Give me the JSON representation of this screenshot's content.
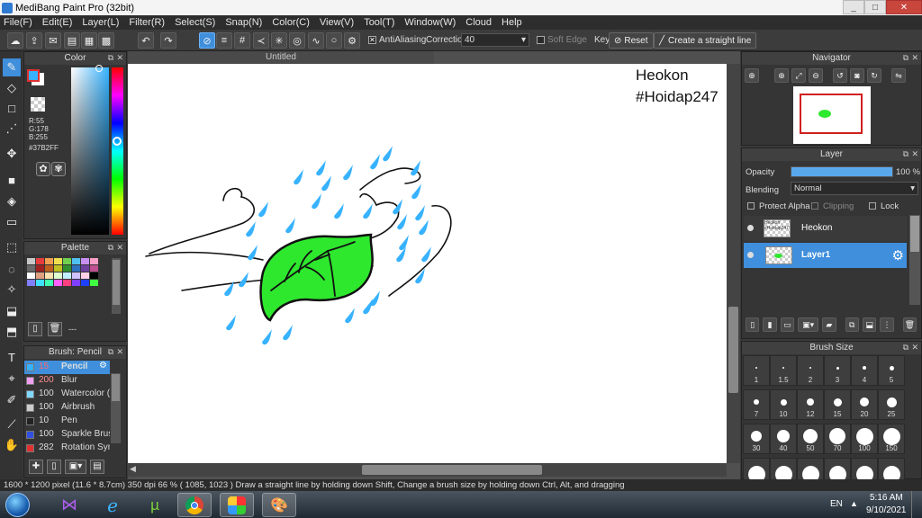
{
  "window": {
    "title": "MediBang Paint Pro (32bit)",
    "minimize": "_",
    "maximize": "□",
    "close": "✕"
  },
  "menu": [
    "File(F)",
    "Edit(E)",
    "Layer(L)",
    "Filter(R)",
    "Select(S)",
    "Snap(N)",
    "Color(C)",
    "View(V)",
    "Tool(T)",
    "Window(W)",
    "Cloud",
    "Help"
  ],
  "toolbar": {
    "antialiasing": "AntiAliasing",
    "correction_label": "Correction",
    "correction_value": "40",
    "soft_edge": "Soft Edge",
    "key_label": "Key",
    "reset": "Reset",
    "straight_line": "Create a straight line"
  },
  "color_panel": {
    "title": "Color",
    "r": "R:55",
    "g": "G:178",
    "b": "B:255",
    "hex": "#37B2FF",
    "primary_color": "#37B2FF",
    "secondary_color": "#FFFFFF"
  },
  "palette_panel": {
    "title": "Palette",
    "more": "---",
    "swatches": [
      "#c8c8c8",
      "#e63c3c",
      "#f0a050",
      "#f0e050",
      "#70d050",
      "#50c0f0",
      "#c890f0",
      "#f8a0c8",
      "#6a6a6a",
      "#a02020",
      "#c06020",
      "#c0c020",
      "#309030",
      "#3070c0",
      "#7040a0",
      "#c05090",
      "#ffffff",
      "#e0a080",
      "#ffe0b0",
      "#e0ffd0",
      "#c0f0ff",
      "#d0c0ff",
      "#ffd0e8",
      "#000000",
      "#8080ff",
      "#40e0ff",
      "#40ffb0",
      "#ff60ff",
      "#ff4080",
      "#8040ff",
      "#2040ff",
      "#40ff40"
    ]
  },
  "brush_panel": {
    "title": "Brush: Pencil",
    "items": [
      {
        "size": "15",
        "name": "Pencil",
        "color": "#37B2FF",
        "selected": true
      },
      {
        "size": "200",
        "name": "Blur",
        "color": "#f0a0f0",
        "selected": false
      },
      {
        "size": "100",
        "name": "Watercolor (V",
        "color": "#80d8ff",
        "selected": false
      },
      {
        "size": "100",
        "name": "Airbrush",
        "color": "#cccccc",
        "selected": false
      },
      {
        "size": "10",
        "name": "Pen",
        "color": "#222222",
        "selected": false
      },
      {
        "size": "100",
        "name": "Sparkle Brush",
        "color": "#3050e0",
        "selected": false
      },
      {
        "size": "282",
        "name": "Rotation Sym",
        "color": "#e03030",
        "selected": false
      }
    ]
  },
  "document": {
    "tab": "Untitled",
    "watermark_line1": "Heokon",
    "watermark_line2": "#Hoidap247"
  },
  "navigator": {
    "title": "Navigator"
  },
  "layer_panel": {
    "title": "Layer",
    "opacity_label": "Opacity",
    "opacity_value": "100 %",
    "opacity_percent": 100,
    "blending_label": "Blending",
    "blending_value": "Normal",
    "protect_alpha": "Protect Alpha",
    "clipping": "Clipping",
    "lock": "Lock",
    "layers": [
      {
        "name": "Heokon",
        "selected": false
      },
      {
        "name": "Layer1",
        "selected": true
      }
    ],
    "thumb_text": "Heokon #Hoidap247"
  },
  "brush_size_panel": {
    "title": "Brush Size",
    "sizes": [
      "1",
      "1.5",
      "2",
      "3",
      "4",
      "5",
      "7",
      "10",
      "12",
      "15",
      "20",
      "25",
      "30",
      "40",
      "50",
      "70",
      "100",
      "150"
    ]
  },
  "status": {
    "text": "1600 * 1200 pixel   (11.6 * 8.7cm)   350 dpi   66 %   ( 1085, 1023 )   Draw a straight line by holding down Shift, Change a brush size by holding down Ctrl, Alt, and dragging"
  },
  "taskbar": {
    "lang": "EN",
    "time": "5:16 AM",
    "date": "9/10/2021"
  },
  "colors": {
    "accent": "#3f8fdc",
    "leaf": "#2ee82e",
    "drops": "#37B2FF"
  }
}
